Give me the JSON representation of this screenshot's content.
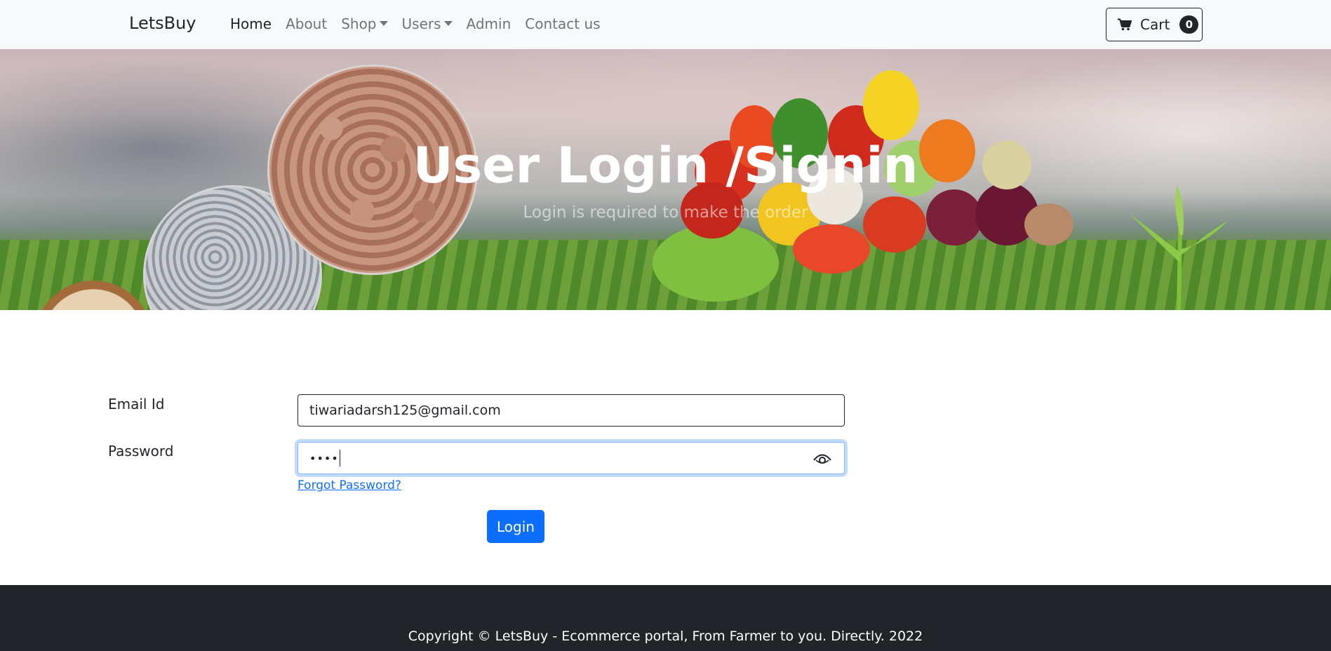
{
  "navbar": {
    "brand": "LetsBuy",
    "links": [
      {
        "label": "Home",
        "active": true,
        "dropdown": false
      },
      {
        "label": "About",
        "active": false,
        "dropdown": false
      },
      {
        "label": "Shop",
        "active": false,
        "dropdown": true
      },
      {
        "label": "Users",
        "active": false,
        "dropdown": true
      },
      {
        "label": "Admin",
        "active": false,
        "dropdown": false
      },
      {
        "label": "Contact us",
        "active": false,
        "dropdown": false
      }
    ],
    "cart": {
      "label": "Cart",
      "count": "0",
      "icon": "cart-icon"
    }
  },
  "hero": {
    "title": "User Login /Signin",
    "subtitle": "Login is required to make the order"
  },
  "form": {
    "email": {
      "label": "Email Id",
      "value": "tiwariadarsh125@gmail.com"
    },
    "password": {
      "label": "Password",
      "value": "••••",
      "icon": "eye-icon"
    },
    "forgot_link": "Forgot Password?",
    "submit_label": "Login"
  },
  "footer": {
    "text": "Copyright © LetsBuy - Ecommerce portal, From Farmer to you. Directly. 2022"
  },
  "colors": {
    "primary": "#0d6efd",
    "dark": "#212529",
    "navbar_bg": "#f8f9fa",
    "muted_link": "#6c757d"
  }
}
